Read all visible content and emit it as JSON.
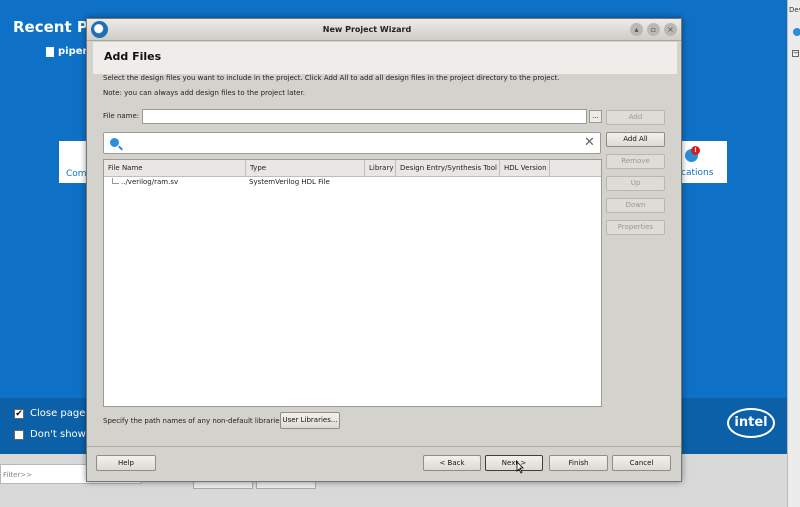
{
  "background": {
    "recent_title": "Recent Pro",
    "recent_item": "pipen",
    "card_left_label": "Com",
    "card_right_label": "cations",
    "card_right_badge": "!",
    "close_page_label": "Close page a",
    "close_page_checked": "✔",
    "dont_show_label": "Don't show t",
    "logo_text": "intel",
    "right_panel_label": "Dev",
    "filter_placeholder": "Filter>>",
    "brand_color": "#0f71c5"
  },
  "dialog": {
    "title": "New Project Wizard",
    "window_controls": [
      "up-arrow-icon",
      "restore-icon",
      "close-icon"
    ],
    "page_title": "Add Files",
    "description": "Select the design files you want to include in the project. Click Add All to add all design files in the project directory to the project.",
    "note": "Note: you can always add design files to the project later.",
    "file_name_label": "File name:",
    "file_name_value": "",
    "browse_label": "...",
    "side_buttons": {
      "add": "Add",
      "add_all": "Add All",
      "remove": "Remove",
      "up": "Up",
      "down": "Down",
      "properties": "Properties"
    },
    "search": {
      "value": ""
    },
    "table": {
      "columns": [
        "File Name",
        "Type",
        "Library",
        "Design Entry/Synthesis Tool",
        "HDL Version"
      ],
      "rows": [
        {
          "file_name": "../verilog/ram.sv",
          "type": "SystemVerilog HDL File",
          "library": "",
          "tool": "",
          "hdl_version": ""
        }
      ]
    },
    "libraries_label": "Specify the path names of any non-default libraries.",
    "user_libraries_button": "User Libraries...",
    "footer": {
      "help": "Help",
      "back": "< Back",
      "next": "Next >",
      "finish": "Finish",
      "cancel": "Cancel"
    }
  }
}
